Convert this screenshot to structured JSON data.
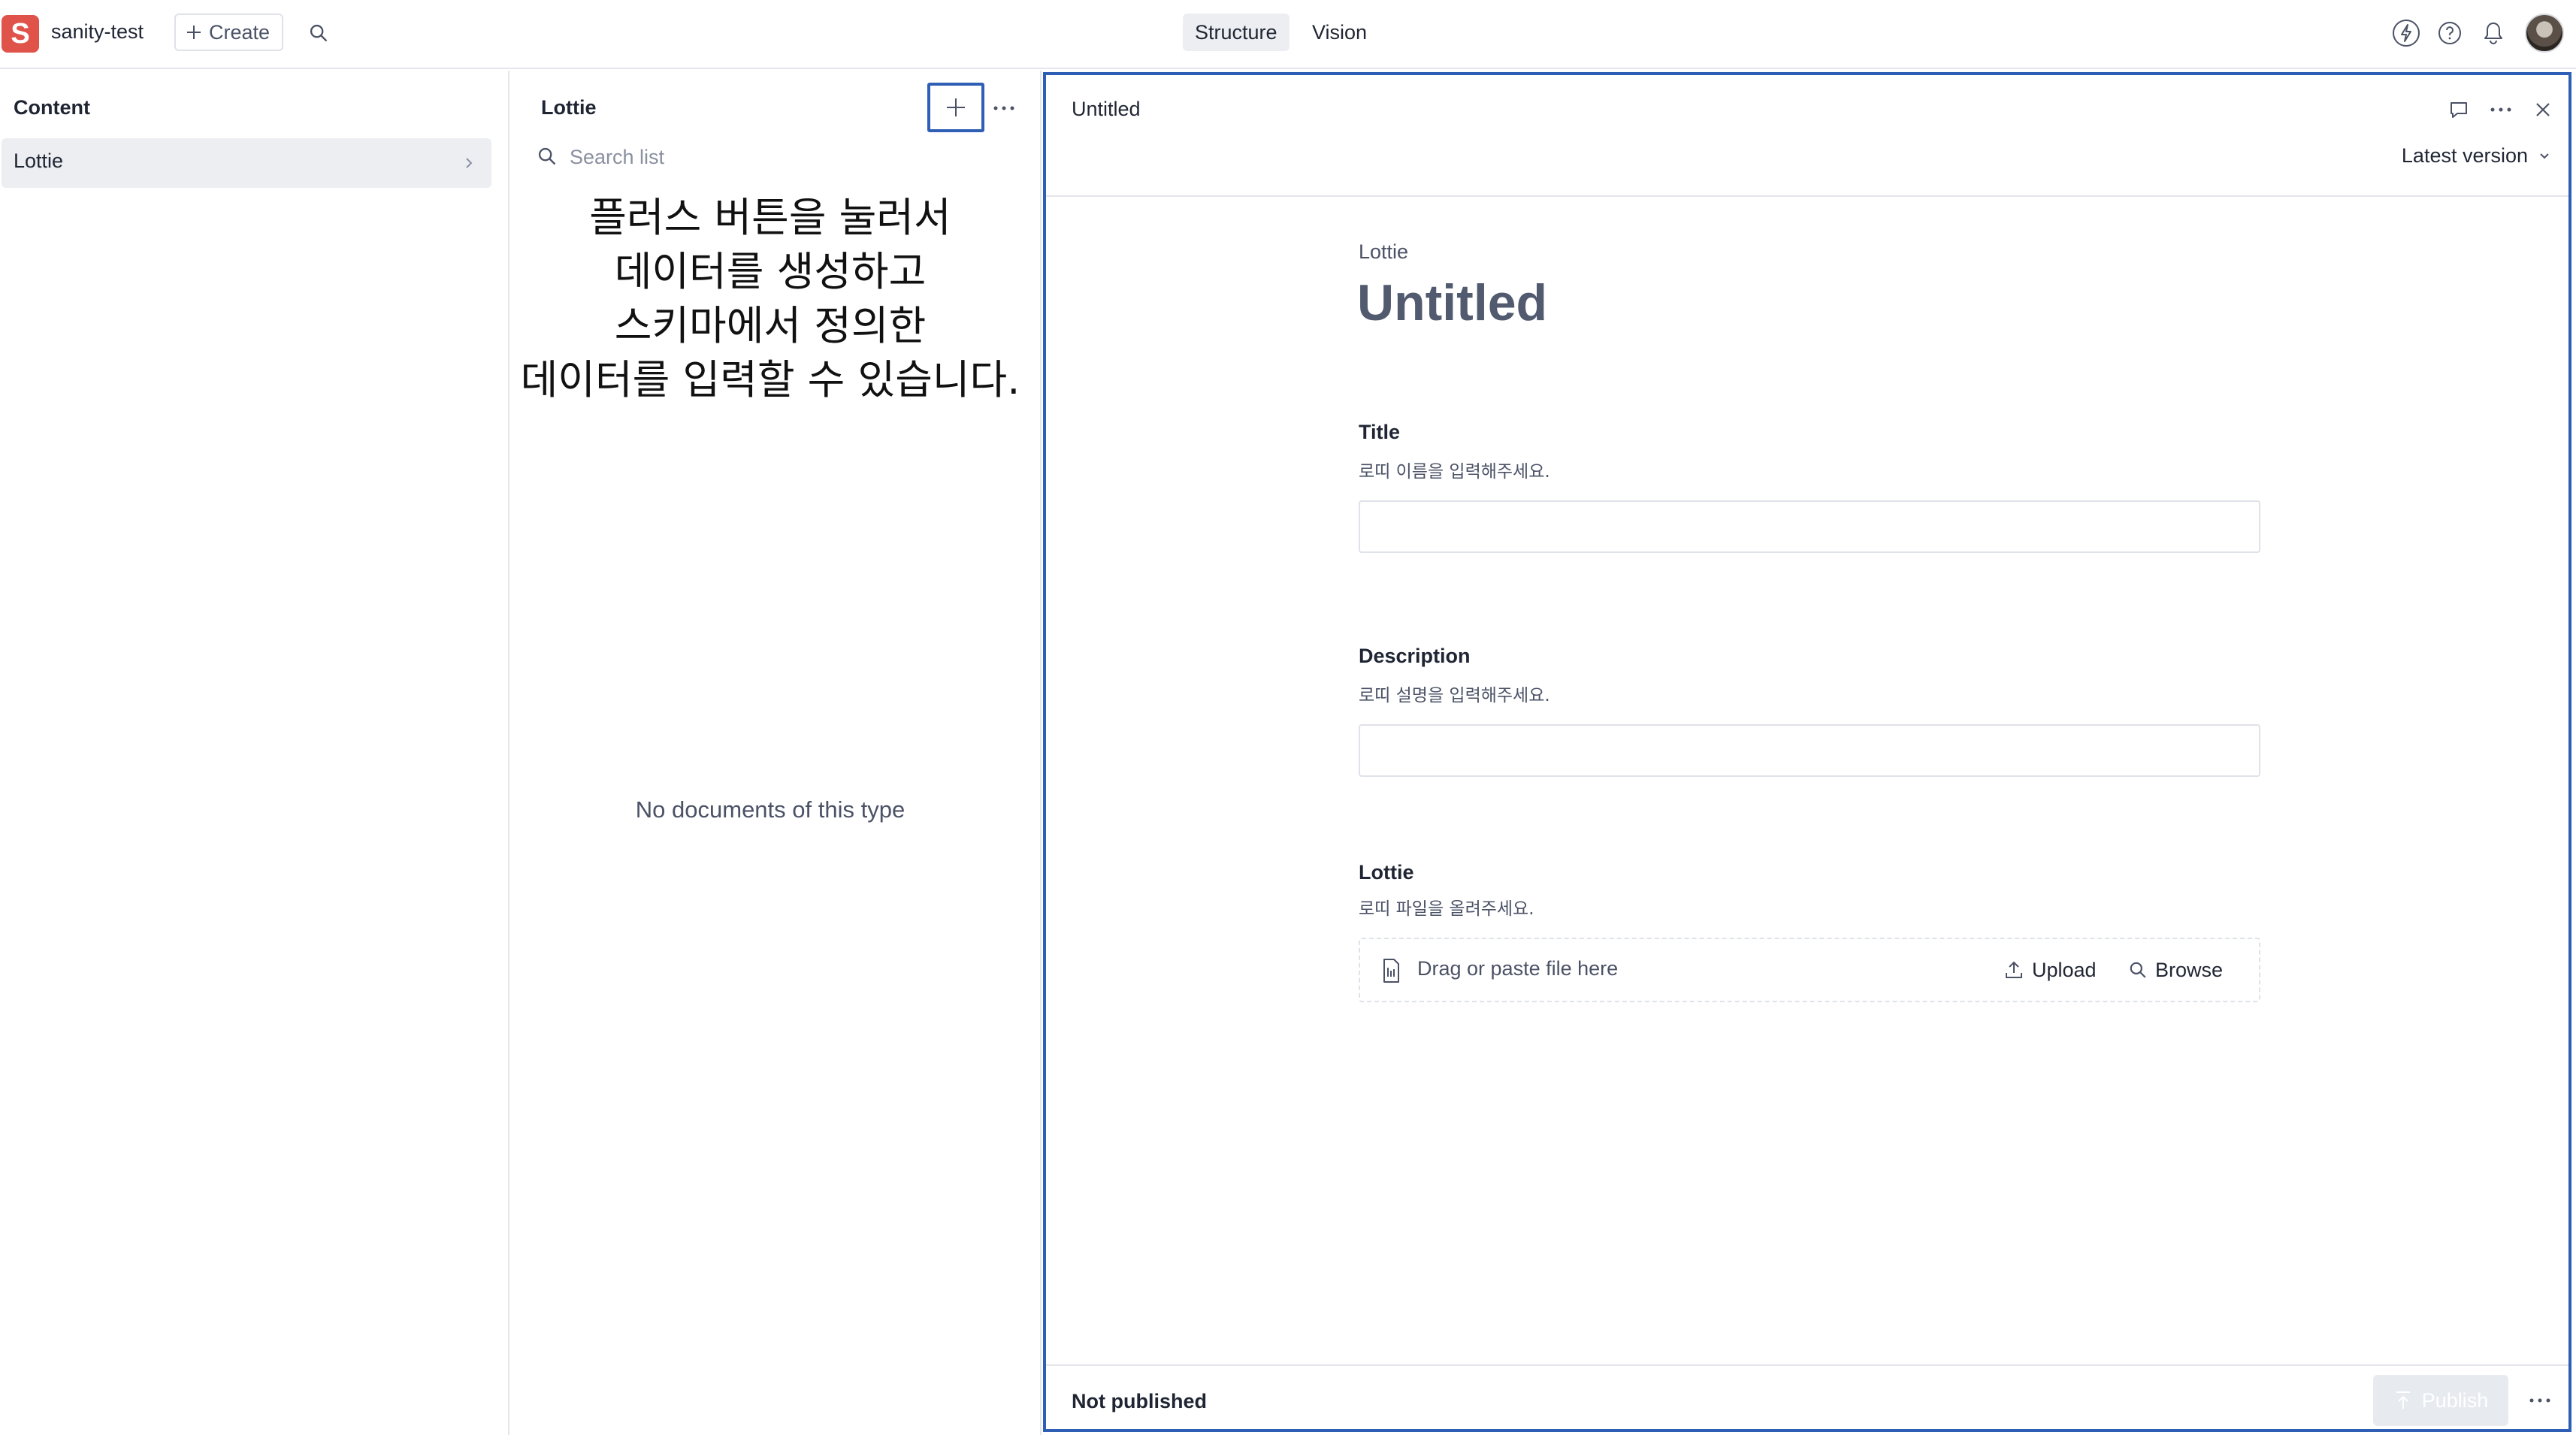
{
  "topbar": {
    "logo_letter": "S",
    "project_name": "sanity-test",
    "create_label": "Create",
    "tabs": [
      {
        "label": "Structure",
        "active": true
      },
      {
        "label": "Vision",
        "active": false
      }
    ]
  },
  "content_pane": {
    "title": "Content",
    "items": [
      {
        "label": "Lottie",
        "selected": true
      }
    ]
  },
  "list_pane": {
    "title": "Lottie",
    "search_placeholder": "Search list",
    "annotation_lines": [
      "플러스 버튼을 눌러서",
      "데이터를 생성하고",
      "스키마에서 정의한",
      "데이터를 입력할 수 있습니다."
    ],
    "empty_text": "No documents of this type"
  },
  "document_pane": {
    "header_title": "Untitled",
    "version_label": "Latest version",
    "type_label": "Lottie",
    "title": "Untitled",
    "fields": [
      {
        "label": "Title",
        "description": "로띠 이름을 입력해주세요.",
        "value": ""
      },
      {
        "label": "Description",
        "description": "로띠 설명을 입력해주세요.",
        "value": ""
      },
      {
        "label": "Lottie",
        "description": "로띠 파일을 올려주세요."
      }
    ],
    "file_drop": {
      "text": "Drag or paste file here",
      "upload_label": "Upload",
      "browse_label": "Browse"
    },
    "status": "Not published",
    "publish_label": "Publish"
  },
  "colors": {
    "brand": "#e0534a",
    "highlight_border": "#2f5fb5",
    "selected_bg": "#eceef2",
    "disabled_button": "#e7eaef"
  },
  "icons": [
    "plus-icon",
    "search-icon",
    "lightning-icon",
    "help-icon",
    "bell-icon",
    "chevron-right-icon",
    "more-icon",
    "comment-icon",
    "close-icon",
    "chevron-down-icon",
    "file-icon",
    "upload-icon",
    "publish-icon"
  ]
}
